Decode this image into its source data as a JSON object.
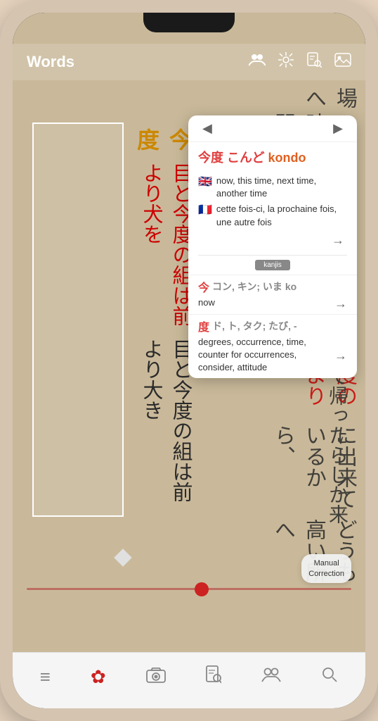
{
  "app": {
    "title": "Words"
  },
  "nav": {
    "title": "Words",
    "icons": [
      "people-icon",
      "sparkles-icon",
      "search-doc-icon",
      "image-icon"
    ]
  },
  "popup": {
    "prev_label": "◀",
    "next_label": "▶",
    "word": {
      "kanji": "今度",
      "kana": "こんど",
      "romaji": "kondo"
    },
    "definitions": {
      "english": {
        "flag": "🇬🇧",
        "text": "now, this time, next time, another time"
      },
      "french": {
        "flag": "🇫🇷",
        "text": "cette fois-ci, la prochaine fois, une autre fois"
      }
    },
    "kanjis_label": "kanjis",
    "kanji_entries": [
      {
        "kanji": "今",
        "reading": "コン, キン; いま",
        "reading_overflow": "ko",
        "definition": "now"
      },
      {
        "kanji": "度",
        "reading": "ド, ト, タク; たび, -",
        "definition": "degrees, occurrence, time, counter for occurrences, consider, attitude"
      }
    ]
  },
  "slider": {
    "position": 54
  },
  "manual_correction": {
    "label": "Manual\nCorrection"
  },
  "tab_bar": {
    "items": [
      {
        "icon": "≡",
        "label": "menu",
        "active": false
      },
      {
        "icon": "✿",
        "label": "home",
        "active": true
      },
      {
        "icon": "🎬",
        "label": "camera",
        "active": false
      },
      {
        "icon": "📋",
        "label": "docs",
        "active": false
      },
      {
        "icon": "👥",
        "label": "people",
        "active": false
      },
      {
        "icon": "🔍",
        "label": "search",
        "active": false
      }
    ]
  },
  "japanese_text": {
    "bg_columns": [
      "一時間に出来ているから",
      "目と今度の組は前より大き",
      "に白墨を時控所はて前より犬を出",
      "場へ",
      "どうも高い所へ",
      "に来て帰ったらしか来"
    ]
  }
}
